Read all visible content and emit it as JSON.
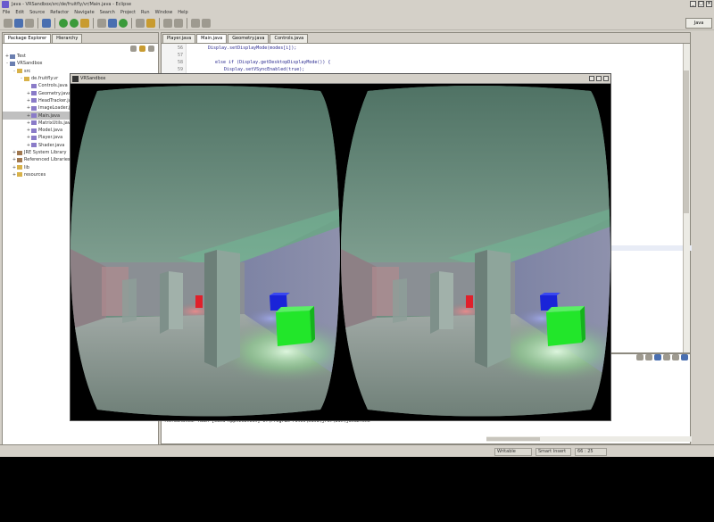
{
  "eclipse": {
    "title": "Java - VRSandbox/src/de/fruitfly/vr/Main.java - Eclipse",
    "menu": [
      "File",
      "Edit",
      "Source",
      "Refactor",
      "Navigate",
      "Search",
      "Project",
      "Run",
      "Window",
      "Help"
    ],
    "perspective_label": "Java",
    "package_explorer": {
      "tabs": [
        "Package Explorer",
        "Hierarchy"
      ],
      "tree": [
        {
          "label": "Test",
          "type": "proj",
          "exp": "+",
          "indent": 0
        },
        {
          "label": "VRSandbox",
          "type": "proj",
          "exp": "-",
          "indent": 0
        },
        {
          "label": "src",
          "type": "fold",
          "exp": "-",
          "indent": 1
        },
        {
          "label": "de.fruitfly.vr",
          "type": "fold",
          "exp": "-",
          "indent": 2
        },
        {
          "label": "Controls.java",
          "type": "file",
          "exp": "",
          "indent": 3
        },
        {
          "label": "Geometry.java",
          "type": "file",
          "exp": "+",
          "indent": 3
        },
        {
          "label": "HeadTracker.java",
          "type": "file",
          "exp": "+",
          "indent": 3
        },
        {
          "label": "ImageLoader.java",
          "type": "file",
          "exp": "+",
          "indent": 3
        },
        {
          "label": "Main.java",
          "type": "file",
          "exp": "+",
          "indent": 3,
          "selected": true
        },
        {
          "label": "MatrixUtils.java",
          "type": "file",
          "exp": "+",
          "indent": 3
        },
        {
          "label": "Model.java",
          "type": "file",
          "exp": "+",
          "indent": 3
        },
        {
          "label": "Player.java",
          "type": "file",
          "exp": "+",
          "indent": 3
        },
        {
          "label": "Shader.java",
          "type": "file",
          "exp": "+",
          "indent": 3
        },
        {
          "label": "JRE System Library",
          "type": "lib",
          "exp": "+",
          "indent": 1
        },
        {
          "label": "Referenced Libraries",
          "type": "lib",
          "exp": "+",
          "indent": 1
        },
        {
          "label": "lib",
          "type": "fold",
          "exp": "+",
          "indent": 1
        },
        {
          "label": "resources",
          "type": "fold",
          "exp": "+",
          "indent": 1
        }
      ]
    },
    "editor": {
      "tabs": [
        "Player.java",
        "Main.java",
        "Geometry.java",
        "Controls.java"
      ],
      "lines": [
        {
          "n": "56",
          "code": "Display.setDisplayMode(modes[i]);"
        },
        {
          "n": "57",
          "code": ""
        },
        {
          "n": "58",
          "code": "else if (Display.getDesktopDisplayMode()) {"
        },
        {
          "n": "59",
          "code": "    Display.setVSyncEnabled(true);"
        },
        {
          "n": "60",
          "code": "}"
        }
      ]
    },
    "console": {
      "line": "<terminated> Main [Java Application] C:\\Program Files\\Java\\jre7\\bin\\javaw.exe"
    },
    "status": [
      "Writable",
      "Smart Insert",
      "66 : 25"
    ]
  },
  "viewer": {
    "title": "VRSandbox"
  },
  "colors": {
    "red_cube": "#e0202a",
    "blue_cube": "#1a24d8",
    "green_cube": "#22e62a",
    "room_wall": "#6d8a7e"
  }
}
